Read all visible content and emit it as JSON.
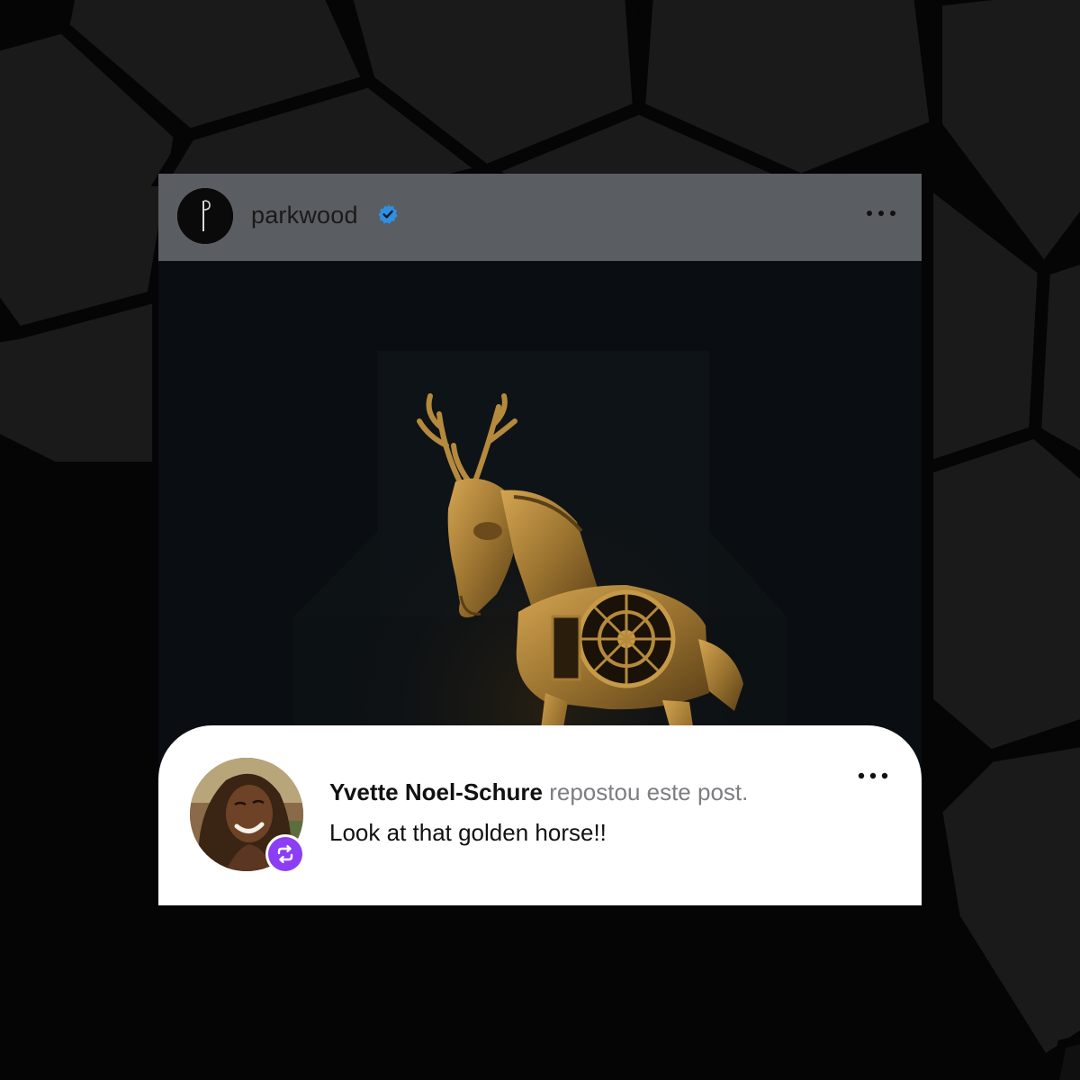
{
  "post": {
    "username": "parkwood",
    "verified": true,
    "icons": {
      "avatar": "parkwood-logo-icon",
      "verified": "verified-badge-icon",
      "more": "more-options-icon"
    },
    "image": {
      "subject": "golden mechanical reindeer-horse sculpture",
      "colors": {
        "background": "#0a0e12",
        "gold": "#b58a3c"
      }
    }
  },
  "repost": {
    "reposter_name": "Yvette Noel-Schure",
    "action_text": "repostou este post.",
    "comment": "Look at that golden horse!!",
    "badge_color": "#8b3ef5",
    "icons": {
      "avatar": "user-avatar",
      "badge": "repost-icon",
      "more": "more-options-icon"
    }
  }
}
